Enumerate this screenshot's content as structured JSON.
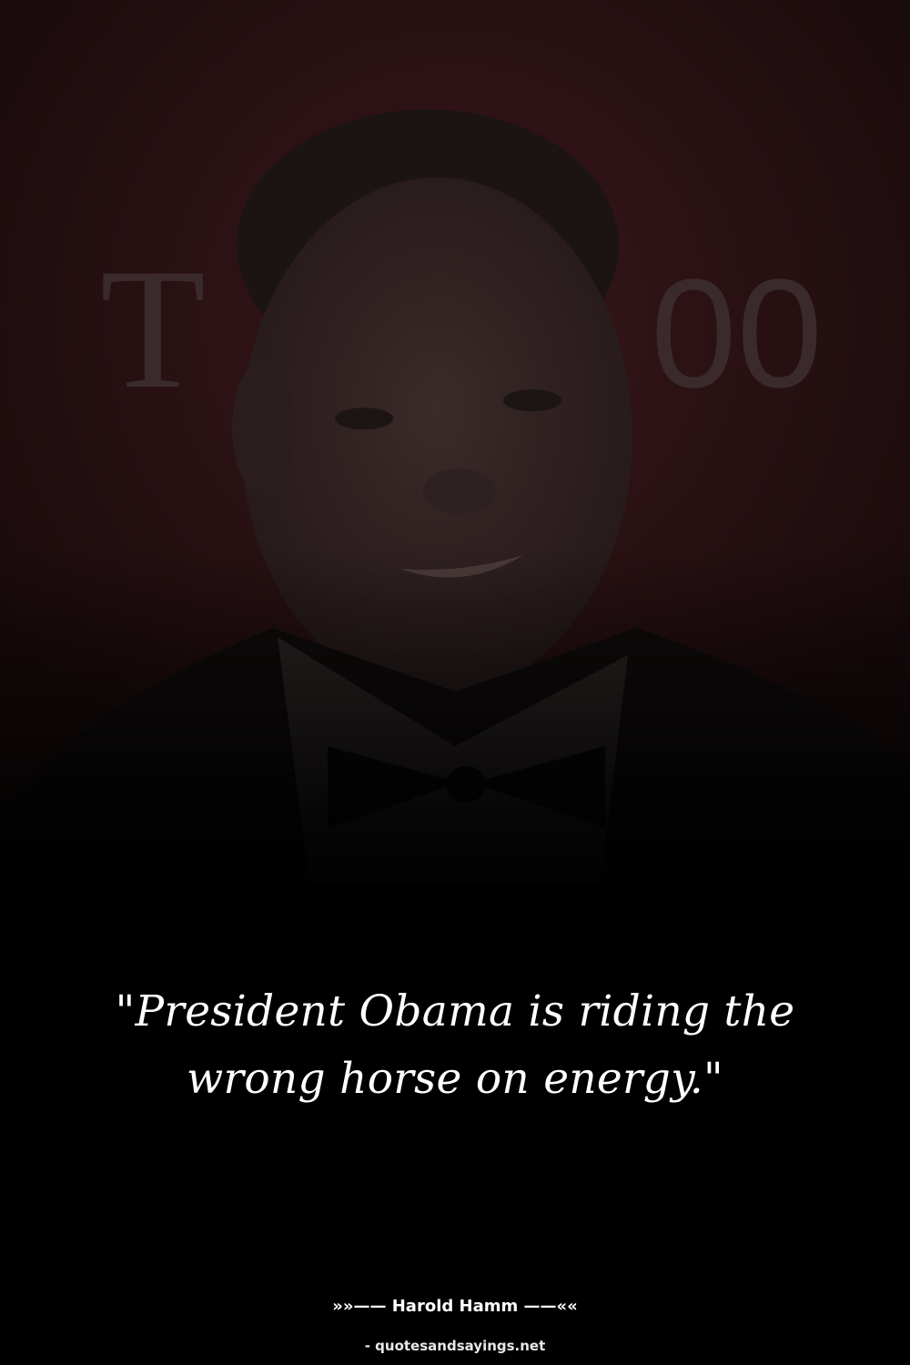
{
  "quote": {
    "text": "\"President Obama is riding the wrong horse on energy.\""
  },
  "author": {
    "line": "»»—— Harold Hamm ——««"
  },
  "source": {
    "line": "- quotesandsayings.net"
  },
  "background": {
    "backdrop_text_left": "T",
    "backdrop_text_right": "00",
    "colors": {
      "backdrop": "#2a1215",
      "backdrop_text": "#3a2a2c",
      "text": "#ffffff"
    }
  }
}
